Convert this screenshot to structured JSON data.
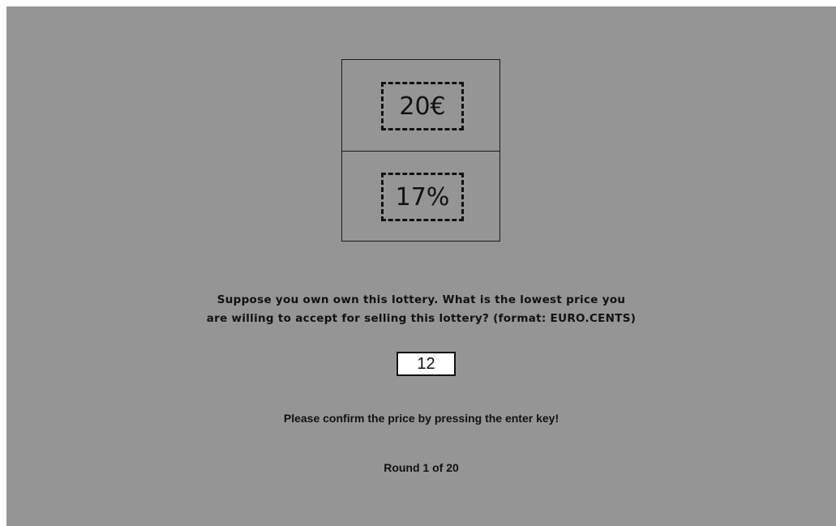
{
  "lottery": {
    "prize": "20€",
    "probability": "17%"
  },
  "question": {
    "line1": "Suppose you own own this lottery. What is the lowest price you",
    "line2": "are willing to accept for selling this lottery? (format: EURO.CENTS)"
  },
  "price_input": {
    "value": "12"
  },
  "instruction": "Please confirm the price by pressing the enter key!",
  "round_text": "Round 1 of 20",
  "colors": {
    "background": "#959595",
    "border": "#111111"
  }
}
